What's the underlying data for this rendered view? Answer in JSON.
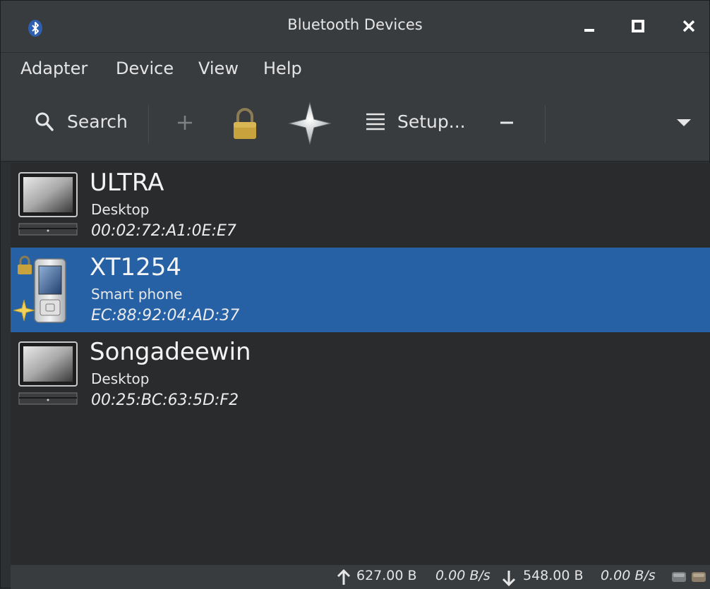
{
  "window": {
    "title": "Bluetooth Devices",
    "icon": "bluetooth-icon"
  },
  "menu": {
    "items": [
      "Adapter",
      "Device",
      "View",
      "Help"
    ]
  },
  "toolbar": {
    "search_label": "Search",
    "add_icon": "plus-icon",
    "trust_icon": "lock-icon",
    "pair_icon": "star-icon",
    "setup_label": "Setup...",
    "remove_icon": "minus-icon",
    "overflow_icon": "chevron-down-icon"
  },
  "devices": [
    {
      "name": "ULTRA",
      "type": "Desktop",
      "address": "00:02:72:A1:0E:E7",
      "icon": "desktop-computer-icon",
      "selected": false,
      "trusted": false,
      "paired": false
    },
    {
      "name": "XT1254",
      "type": "Smart phone",
      "address": "EC:88:92:04:AD:37",
      "icon": "smartphone-icon",
      "selected": true,
      "trusted": true,
      "paired": true
    },
    {
      "name": "Songadeewin",
      "type": "Desktop",
      "address": "00:25:BC:63:5D:F2",
      "icon": "desktop-computer-icon",
      "selected": false,
      "trusted": false,
      "paired": false
    }
  ],
  "status": {
    "upload_total": "627.00 B",
    "upload_rate": "0.00 B/s",
    "download_total": "548.00 B",
    "download_rate": "0.00 B/s"
  },
  "colors": {
    "selection": "#2561a4",
    "lock_gold": "#c8a23c",
    "star_gold": "#f0d25a"
  }
}
